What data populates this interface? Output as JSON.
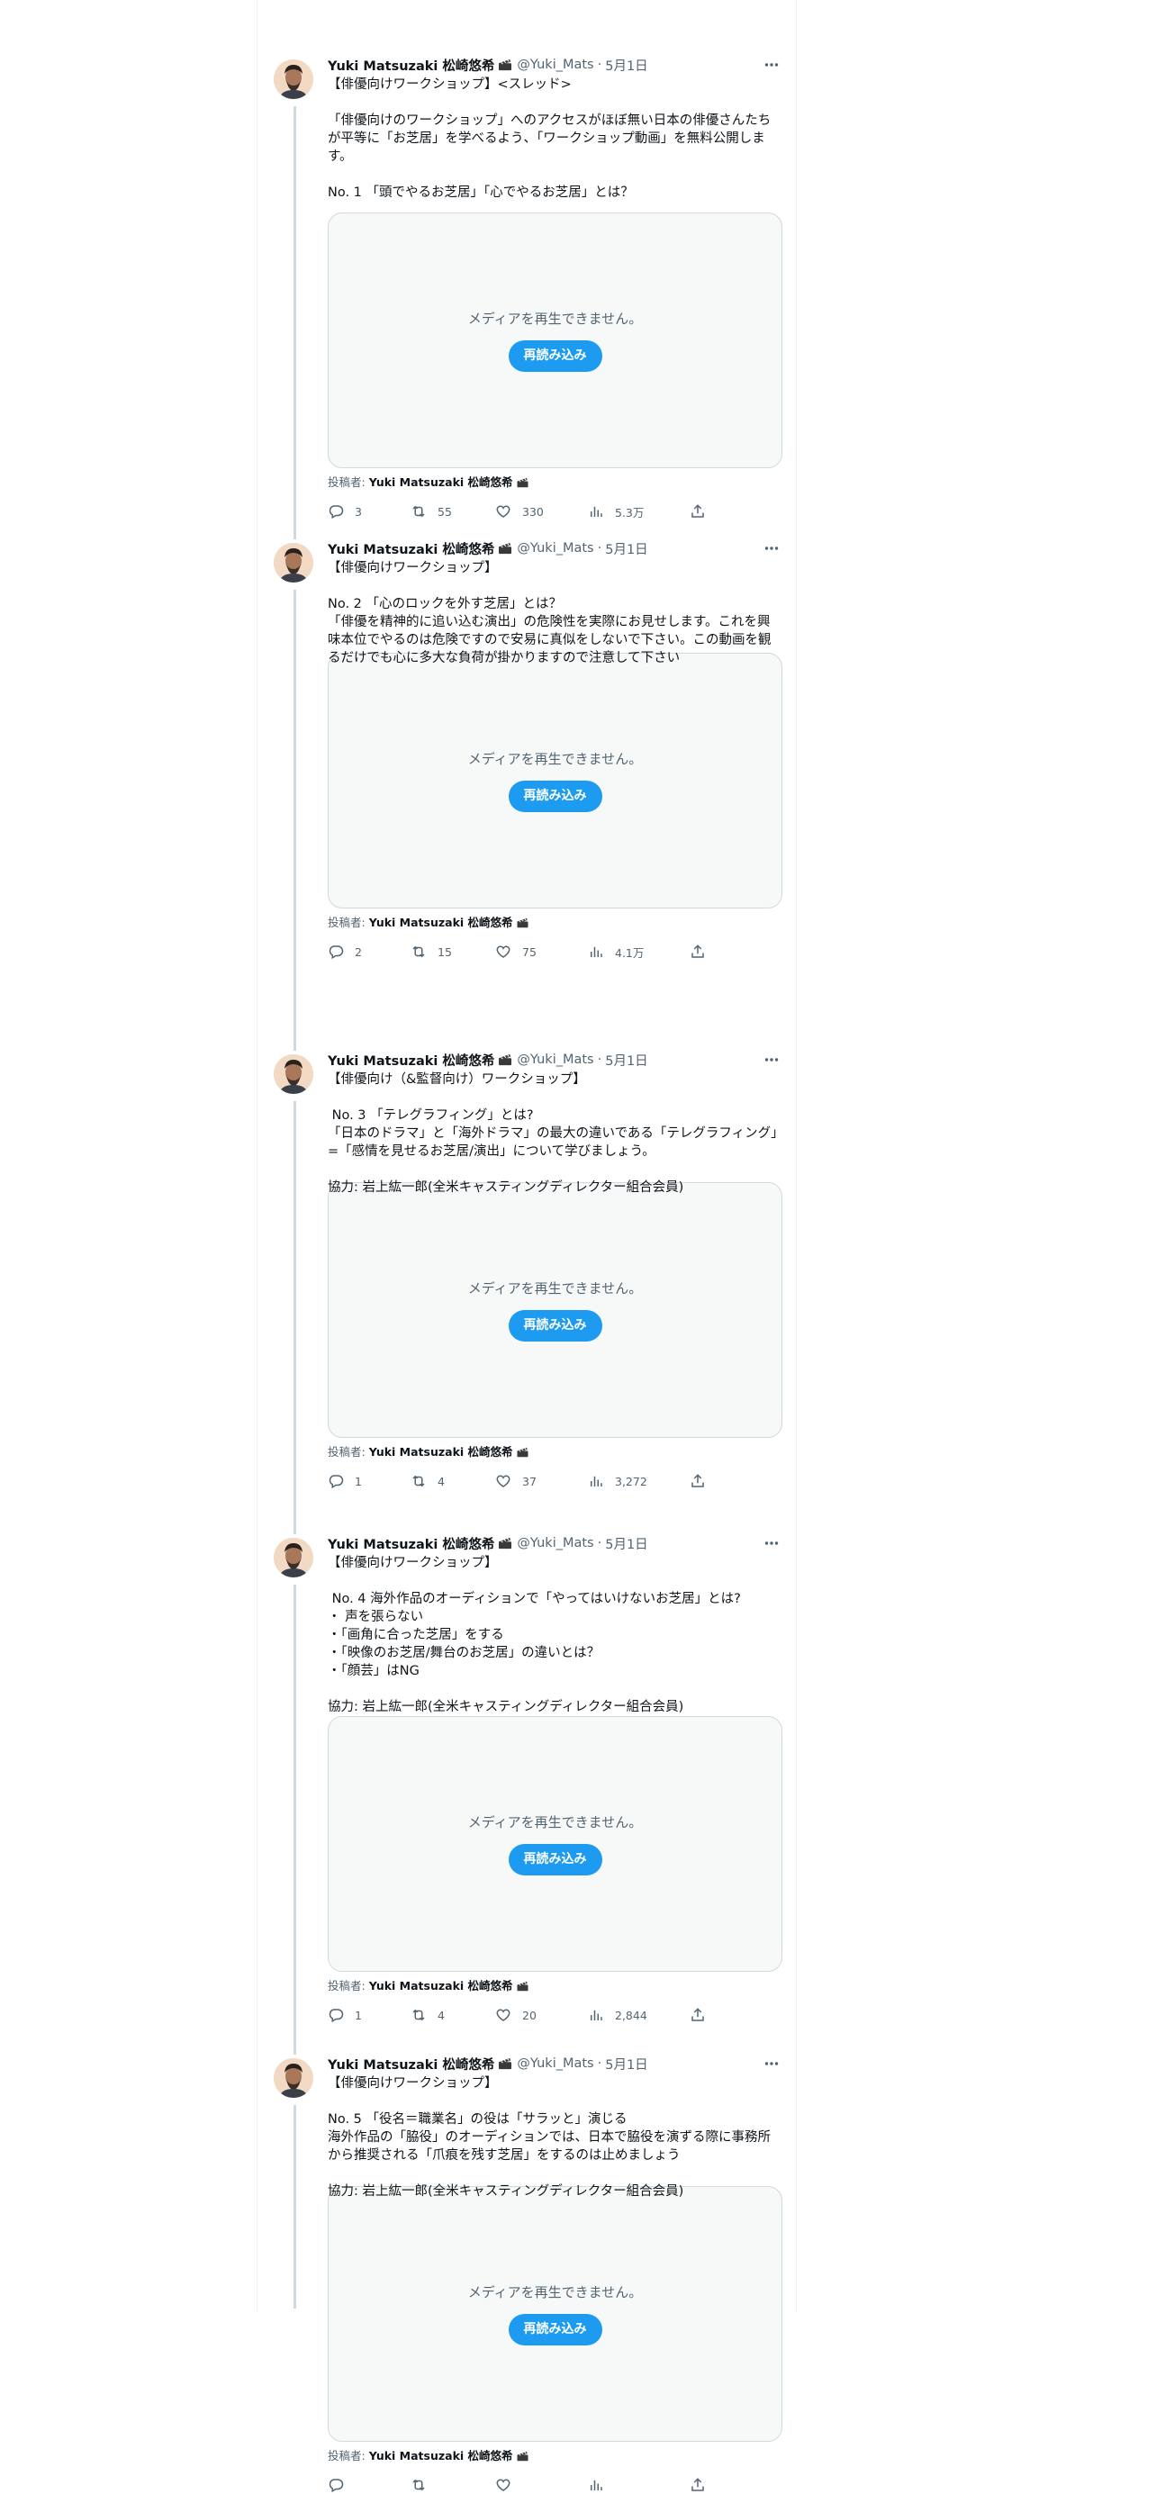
{
  "author": {
    "name": "Yuki Matsuzaki 松崎悠希",
    "handle": "@Yuki_Mats",
    "dot": "·",
    "byline_prefix": "投稿者: "
  },
  "media": {
    "error_message": "メディアを再生できません。",
    "reload_label": "再読み込み"
  },
  "tweets": [
    {
      "date": "5月1日",
      "text": "【俳優向けワークショップ】<スレッド>\n\n「俳優向けのワークショップ」へのアクセスがほぼ無い日本の俳優さんたちが平等に「お芝居」を学べるよう、「ワークショップ動画」を無料公開します。\n\nNo. 1 「頭でやるお芝居」「心でやるお芝居」とは？",
      "stats": {
        "replies": "3",
        "reposts": "55",
        "likes": "330",
        "views": "5.3万"
      }
    },
    {
      "date": "5月1日",
      "text": "【俳優向けワークショップ】\n\nNo. 2 「心のロックを外す芝居」とは？\n「俳優を精神的に追い込む演出」の危険性を実際にお見せします。これを興味本位でやるのは危険ですので安易に真似をしないで下さい。この動画を観るだけでも心に多大な負荷が掛かりますので注意して下さい",
      "stats": {
        "replies": "2",
        "reposts": "15",
        "likes": "75",
        "views": "4.1万"
      }
    },
    {
      "date": "5月1日",
      "text": "【俳優向け（&監督向け）ワークショップ】\n\n No. 3 「テレグラフィング」とは?\n「日本のドラマ」と「海外ドラマ」の最大の違いである「テレグラフィング」=「感情を見せるお芝居/演出」について学びましょう。\n\n協力: 岩上紘一郎(全米キャスティングディレクター組合会員)",
      "stats": {
        "replies": "1",
        "reposts": "4",
        "likes": "37",
        "views": "3,272"
      }
    },
    {
      "date": "5月1日",
      "text": "【俳優向けワークショップ】\n\n No. 4 海外作品のオーディションで「やってはいけないお芝居」とは?\n・ 声を張らない\n・「画角に合った芝居」をする\n・「映像のお芝居/舞台のお芝居」の違いとは？\n・「顔芸」はNG\n\n協力: 岩上紘一郎(全米キャスティングディレクター組合会員)",
      "stats": {
        "replies": "1",
        "reposts": "4",
        "likes": "20",
        "views": "2,844"
      }
    },
    {
      "date": "5月1日",
      "text": "【俳優向けワークショップ】\n\nNo. 5 「役名＝職業名」の役は「サラッと」演じる\n海外作品の「脇役」のオーディションでは、日本で脇役を演ずる際に事務所から推奨される「爪痕を残す芝居」をするのは止めましょう\n\n協力: 岩上紘一郎(全米キャスティングディレクター組合会員)",
      "stats": {
        "replies": "",
        "reposts": "",
        "likes": "",
        "views": ""
      }
    }
  ]
}
